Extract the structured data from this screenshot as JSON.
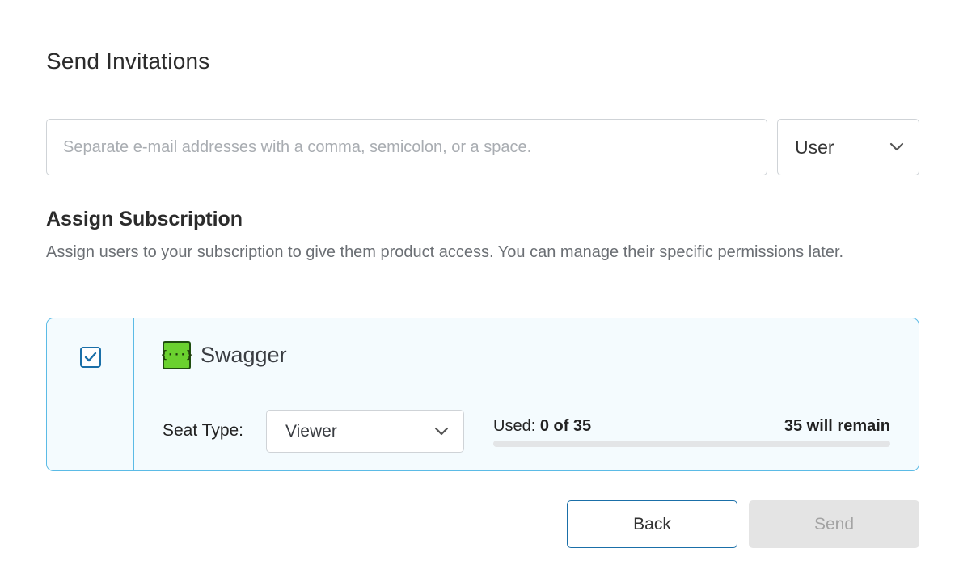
{
  "title": "Send Invitations",
  "email": {
    "value": "",
    "placeholder": "Separate e-mail addresses with a comma, semicolon, or a space."
  },
  "role": {
    "selected": "User"
  },
  "subscription": {
    "title": "Assign Subscription",
    "description": "Assign users to your subscription to give them product access. You can manage their specific permissions later.",
    "product": {
      "checked": true,
      "logo_text": "{···}",
      "name": "Swagger",
      "seat_label": "Seat Type:",
      "seat_type": "Viewer",
      "used_label": "Used:",
      "used_value": "0 of 35",
      "used_fraction": 0,
      "remain_text": "35 will remain"
    }
  },
  "actions": {
    "back_label": "Back",
    "send_label": "Send"
  },
  "colors": {
    "accent": "#1a6fa8",
    "card_border": "#5bbbe6",
    "card_bg": "#f4fbfe",
    "swagger_green": "#6ad12f",
    "disabled_bg": "#e4e4e4"
  }
}
